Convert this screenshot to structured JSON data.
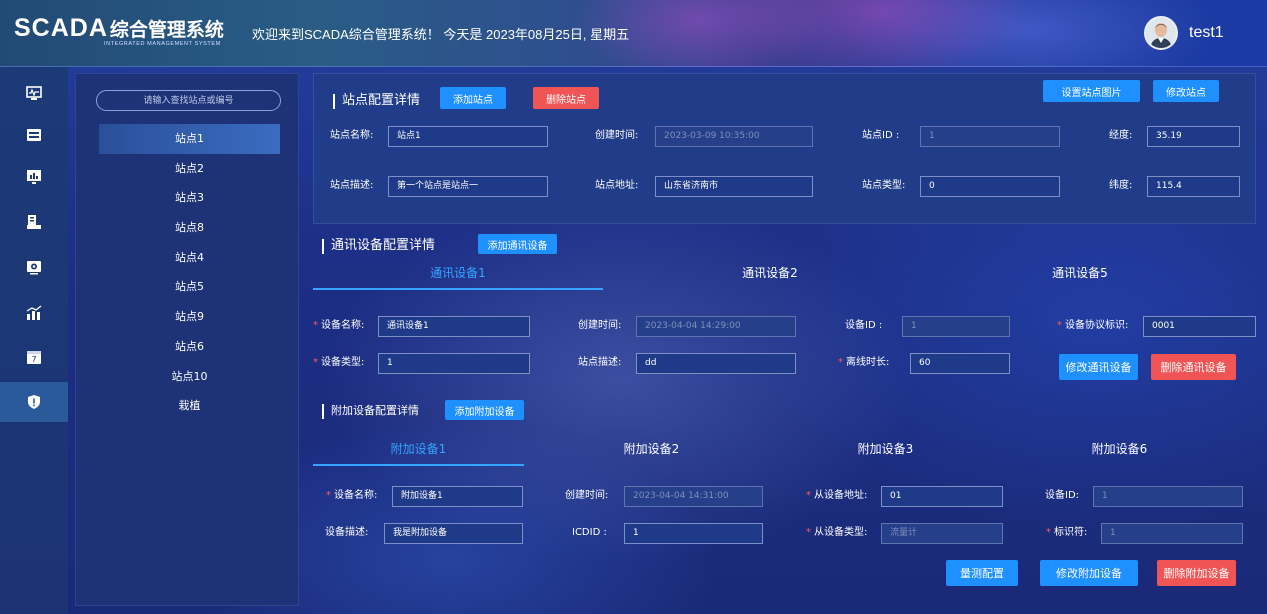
{
  "header": {
    "logo_text": "SCADA",
    "logo_cn": "综合管理系统",
    "logo_sub": "INTEGRATED MANAGEMENT SYSTEM",
    "welcome": "欢迎来到SCADA综合管理系统！ 今天是 2023年08月25日, 星期五",
    "username": "test1"
  },
  "rail": {
    "items": [
      {
        "icon": "monitor-wave-icon"
      },
      {
        "icon": "window-list-icon"
      },
      {
        "icon": "screen-chart-icon"
      },
      {
        "icon": "device-box-icon"
      },
      {
        "icon": "camera-screen-icon"
      },
      {
        "icon": "bar-trend-icon"
      },
      {
        "icon": "calendar-icon"
      },
      {
        "icon": "shield-icon",
        "active": true
      }
    ]
  },
  "stations": {
    "search_placeholder": "请输入查找站点或编号",
    "items": [
      "站点1",
      "站点2",
      "站点3",
      "站点8",
      "站点4",
      "站点5",
      "站点9",
      "站点6",
      "站点10",
      "栽植"
    ],
    "active_index": 0
  },
  "site_config": {
    "title": "站点配置详情",
    "add_button": "添加站点",
    "delete_button": "删除站点",
    "set_image_button": "设置站点图片",
    "edit_button": "修改站点",
    "fields": {
      "name_label": "站点名称:",
      "name_value": "站点1",
      "created_label": "创建时间:",
      "created_value": "2023-03-09 10:35:00",
      "id_label": "站点ID  :",
      "id_value": "1",
      "lng_label": "经度:",
      "lng_value": "35.19",
      "desc_label": "站点描述:",
      "desc_value": "第一个站点是站点一",
      "addr_label": "站点地址:",
      "addr_value": "山东省济南市",
      "type_label": "站点类型:",
      "type_value": "0",
      "lat_label": "纬度:",
      "lat_value": "115.4"
    }
  },
  "comm_config": {
    "title": "通讯设备配置详情",
    "add_button": "添加通讯设备",
    "tabs": [
      "通讯设备1",
      "通讯设备2",
      "通讯设备5"
    ],
    "fields": {
      "name_label": "设备名称:",
      "name_value": "通讯设备1",
      "created_label": "创建时间:",
      "created_value": "2023-04-04 14:29:00",
      "id_label": "设备ID  :",
      "id_value": "1",
      "proto_label": "设备协议标识:",
      "proto_value": "0001",
      "type_label": "设备类型:",
      "type_value": "1",
      "desc_label": "站点描述:",
      "desc_value": "dd",
      "offline_label": "离线时长:",
      "offline_value": "60"
    },
    "edit_button": "修改通讯设备",
    "delete_button": "删除通讯设备"
  },
  "extra_config": {
    "title": "附加设备配置详情",
    "add_button": "添加附加设备",
    "tabs": [
      "附加设备1",
      "附加设备2",
      "附加设备3",
      "附加设备6"
    ],
    "fields": {
      "name_label": "设备名称:",
      "name_value": "附加设备1",
      "created_label": "创建时间:",
      "created_value": "2023-04-04 14:31:00",
      "slave_addr_label": "从设备地址:",
      "slave_addr_value": "01",
      "dev_id_label": "设备ID:",
      "dev_id_value": "1",
      "desc_label": "设备描述:",
      "desc_value": "我是附加设备",
      "icdid_label": "ICDID  :",
      "icdid_value": "1",
      "slave_type_label": "从设备类型:",
      "slave_type_placeholder": "流量计",
      "flag_label": "标识符:",
      "flag_value": "1"
    },
    "measure_button": "量测配置",
    "edit_button": "修改附加设备",
    "delete_button": "删除附加设备"
  }
}
